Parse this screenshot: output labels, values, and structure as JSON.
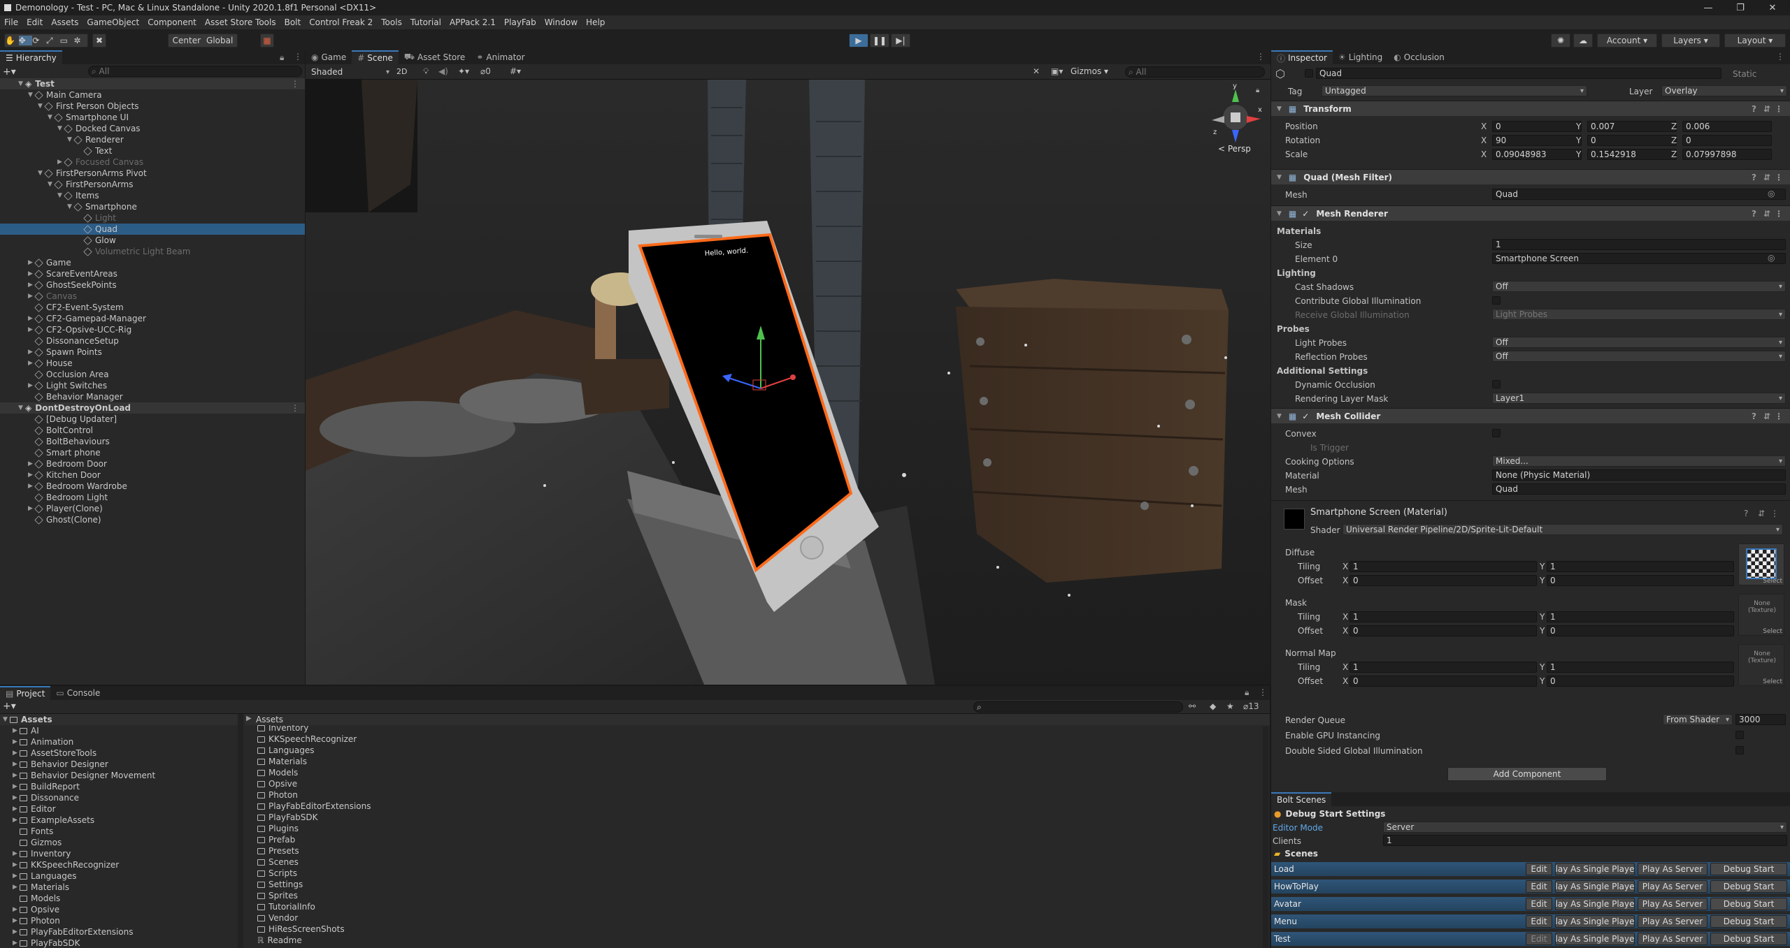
{
  "window": {
    "title": "Demonology - Test - PC, Mac & Linux Standalone - Unity 2020.1.8f1 Personal <DX11>"
  },
  "menu": [
    "File",
    "Edit",
    "Assets",
    "GameObject",
    "Component",
    "Asset Store Tools",
    "Bolt",
    "Control Freak 2",
    "Tools",
    "Tutorial",
    "APPack 2.1",
    "PlayFab",
    "Window",
    "Help"
  ],
  "toolbar": {
    "center": "Center",
    "global": "Global",
    "account": "Account",
    "layers": "Layers",
    "layout": "Layout"
  },
  "hierarchy": {
    "tab": "Hierarchy",
    "search_placeholder": "All",
    "items": [
      {
        "label": "Test",
        "indent": 0,
        "fold": "▼",
        "type": "scene"
      },
      {
        "label": "Main Camera",
        "indent": 1,
        "fold": "▼"
      },
      {
        "label": "First Person Objects",
        "indent": 2,
        "fold": "▼"
      },
      {
        "label": "Smartphone UI",
        "indent": 3,
        "fold": "▼"
      },
      {
        "label": "Docked Canvas",
        "indent": 4,
        "fold": "▼"
      },
      {
        "label": "Renderer",
        "indent": 5,
        "fold": "▼"
      },
      {
        "label": "Text",
        "indent": 6,
        "fold": ""
      },
      {
        "label": "Focused Canvas",
        "indent": 4,
        "fold": "▶",
        "dim": true
      },
      {
        "label": "FirstPersonArms Pivot",
        "indent": 2,
        "fold": "▼"
      },
      {
        "label": "FirstPersonArms",
        "indent": 3,
        "fold": "▼"
      },
      {
        "label": "Items",
        "indent": 4,
        "fold": "▼"
      },
      {
        "label": "Smartphone",
        "indent": 5,
        "fold": "▼"
      },
      {
        "label": "Light",
        "indent": 6,
        "fold": "",
        "dim": true
      },
      {
        "label": "Quad",
        "indent": 6,
        "fold": "",
        "selected": true
      },
      {
        "label": "Glow",
        "indent": 6,
        "fold": ""
      },
      {
        "label": "Volumetric Light Beam",
        "indent": 6,
        "fold": "",
        "dim": true
      },
      {
        "label": "Game",
        "indent": 1,
        "fold": "▶"
      },
      {
        "label": "ScareEventAreas",
        "indent": 1,
        "fold": "▶"
      },
      {
        "label": "GhostSeekPoints",
        "indent": 1,
        "fold": "▶"
      },
      {
        "label": "Canvas",
        "indent": 1,
        "fold": "▶",
        "dim": true
      },
      {
        "label": "CF2-Event-System",
        "indent": 1,
        "fold": ""
      },
      {
        "label": "CF2-Gamepad-Manager",
        "indent": 1,
        "fold": "▶"
      },
      {
        "label": "CF2-Opsive-UCC-Rig",
        "indent": 1,
        "fold": "▶"
      },
      {
        "label": "DissonanceSetup",
        "indent": 1,
        "fold": ""
      },
      {
        "label": "Spawn Points",
        "indent": 1,
        "fold": "▶"
      },
      {
        "label": "House",
        "indent": 1,
        "fold": "▶"
      },
      {
        "label": "Occlusion Area",
        "indent": 1,
        "fold": ""
      },
      {
        "label": "Light Switches",
        "indent": 1,
        "fold": "▶"
      },
      {
        "label": "Behavior Manager",
        "indent": 1,
        "fold": ""
      },
      {
        "label": "DontDestroyOnLoad",
        "indent": 0,
        "fold": "▼",
        "type": "scene"
      },
      {
        "label": "[Debug Updater]",
        "indent": 1,
        "fold": ""
      },
      {
        "label": "BoltControl",
        "indent": 1,
        "fold": ""
      },
      {
        "label": "BoltBehaviours",
        "indent": 1,
        "fold": ""
      },
      {
        "label": "Smart phone",
        "indent": 1,
        "fold": ""
      },
      {
        "label": "Bedroom Door",
        "indent": 1,
        "fold": "▶"
      },
      {
        "label": "Kitchen Door",
        "indent": 1,
        "fold": "▶"
      },
      {
        "label": "Bedroom Wardrobe",
        "indent": 1,
        "fold": "▶"
      },
      {
        "label": "Bedroom Light",
        "indent": 1,
        "fold": ""
      },
      {
        "label": "Player(Clone)",
        "indent": 1,
        "fold": "▶"
      },
      {
        "label": "Ghost(Clone)",
        "indent": 1,
        "fold": ""
      }
    ]
  },
  "scene": {
    "tabs": [
      "Game",
      "Scene",
      "Asset Store",
      "Animator"
    ],
    "active_tab": "Scene",
    "shading": "Shaded",
    "mode_2d": "2D",
    "hidden_count": "0",
    "gizmos": "Gizmos",
    "search_placeholder": "All",
    "persp": "< Persp",
    "screen_text": "Hello, world."
  },
  "inspector": {
    "tabs": [
      "Inspector",
      "Lighting",
      "Occlusion"
    ],
    "object_name": "Quad",
    "static": "Static",
    "tag_label": "Tag",
    "tag": "Untagged",
    "layer_label": "Layer",
    "layer": "Overlay",
    "transform": {
      "title": "Transform",
      "position": {
        "label": "Position",
        "x": "0",
        "y": "0.007",
        "z": "0.006"
      },
      "rotation": {
        "label": "Rotation",
        "x": "90",
        "y": "0",
        "z": "0"
      },
      "scale": {
        "label": "Scale",
        "x": "0.09048983",
        "y": "0.1542918",
        "z": "0.07997898"
      }
    },
    "mesh_filter": {
      "title": "Quad (Mesh Filter)",
      "mesh_label": "Mesh",
      "mesh": "Quad"
    },
    "mesh_renderer": {
      "title": "Mesh Renderer",
      "materials": "Materials",
      "size_label": "Size",
      "size": "1",
      "element0_label": "Element 0",
      "element0": "Smartphone Screen",
      "lighting": "Lighting",
      "cast_shadows_label": "Cast Shadows",
      "cast_shadows": "Off",
      "contribute_gi": "Contribute Global Illumination",
      "receive_gi_label": "Receive Global Illumination",
      "receive_gi": "Light Probes",
      "probes": "Probes",
      "light_probes_label": "Light Probes",
      "light_probes": "Off",
      "reflection_probes_label": "Reflection Probes",
      "reflection_probes": "Off",
      "additional": "Additional Settings",
      "dynamic_occlusion": "Dynamic Occlusion",
      "rendering_layer_label": "Rendering Layer Mask",
      "rendering_layer": "Layer1"
    },
    "mesh_collider": {
      "title": "Mesh Collider",
      "convex": "Convex",
      "is_trigger": "Is Trigger",
      "cooking_label": "Cooking Options",
      "cooking": "Mixed...",
      "material_label": "Material",
      "material": "None (Physic Material)",
      "mesh_label": "Mesh",
      "mesh": "Quad"
    },
    "material": {
      "title": "Smartphone Screen (Material)",
      "shader_label": "Shader",
      "shader": "Universal Render Pipeline/2D/Sprite-Lit-Default",
      "groups": [
        {
          "name": "Diffuse",
          "tiling_x": "1",
          "tiling_y": "1",
          "offset_x": "0",
          "offset_y": "0",
          "tex": ""
        },
        {
          "name": "Mask",
          "tiling_x": "1",
          "tiling_y": "1",
          "offset_x": "0",
          "offset_y": "0",
          "tex": "None\n(Texture)"
        },
        {
          "name": "Normal Map",
          "tiling_x": "1",
          "tiling_y": "1",
          "offset_x": "0",
          "offset_y": "0",
          "tex": "None\n(Texture)"
        }
      ],
      "tiling": "Tiling",
      "offset": "Offset",
      "select": "Select",
      "render_queue_label": "Render Queue",
      "render_queue_mode": "From Shader",
      "render_queue": "3000",
      "gpu_instancing": "Enable GPU Instancing",
      "double_sided_gi": "Double Sided Global Illumination"
    },
    "add_component": "Add Component"
  },
  "bolt": {
    "tab": "Bolt Scenes",
    "debug_title": "Debug Start Settings",
    "editor_mode_label": "Editor Mode",
    "editor_mode": "Server",
    "clients_label": "Clients",
    "clients": "1",
    "scenes_title": "Scenes",
    "edit": "Edit",
    "single": "lay As Single Playe",
    "server": "Play As Server",
    "debug": "Debug Start",
    "scenes": [
      "Load",
      "HowToPlay",
      "Avatar",
      "Menu",
      "Test"
    ]
  },
  "project": {
    "tabs": [
      "Project",
      "Console"
    ],
    "count": "13",
    "tree_root": "Assets",
    "tree": [
      "AI",
      "Animation",
      "AssetStoreTools",
      "Behavior Designer",
      "Behavior Designer Movement",
      "BuildReport",
      "Dissonance",
      "Editor",
      "ExampleAssets",
      "Fonts",
      "Gizmos",
      "Inventory",
      "KKSpeechRecognizer",
      "Languages",
      "Materials",
      "Models",
      "Opsive",
      "Photon",
      "PlayFabEditorExtensions",
      "PlayFabSDK"
    ],
    "breadcrumb": "Assets",
    "list": [
      "Inventory",
      "KKSpeechRecognizer",
      "Languages",
      "Materials",
      "Models",
      "Opsive",
      "Photon",
      "PlayFabEditorExtensions",
      "PlayFabSDK",
      "Plugins",
      "Prefab",
      "Presets",
      "Scenes",
      "Scripts",
      "Settings",
      "Sprites",
      "TutorialInfo",
      "Vendor",
      "HiResScreenShots",
      "Readme"
    ]
  }
}
